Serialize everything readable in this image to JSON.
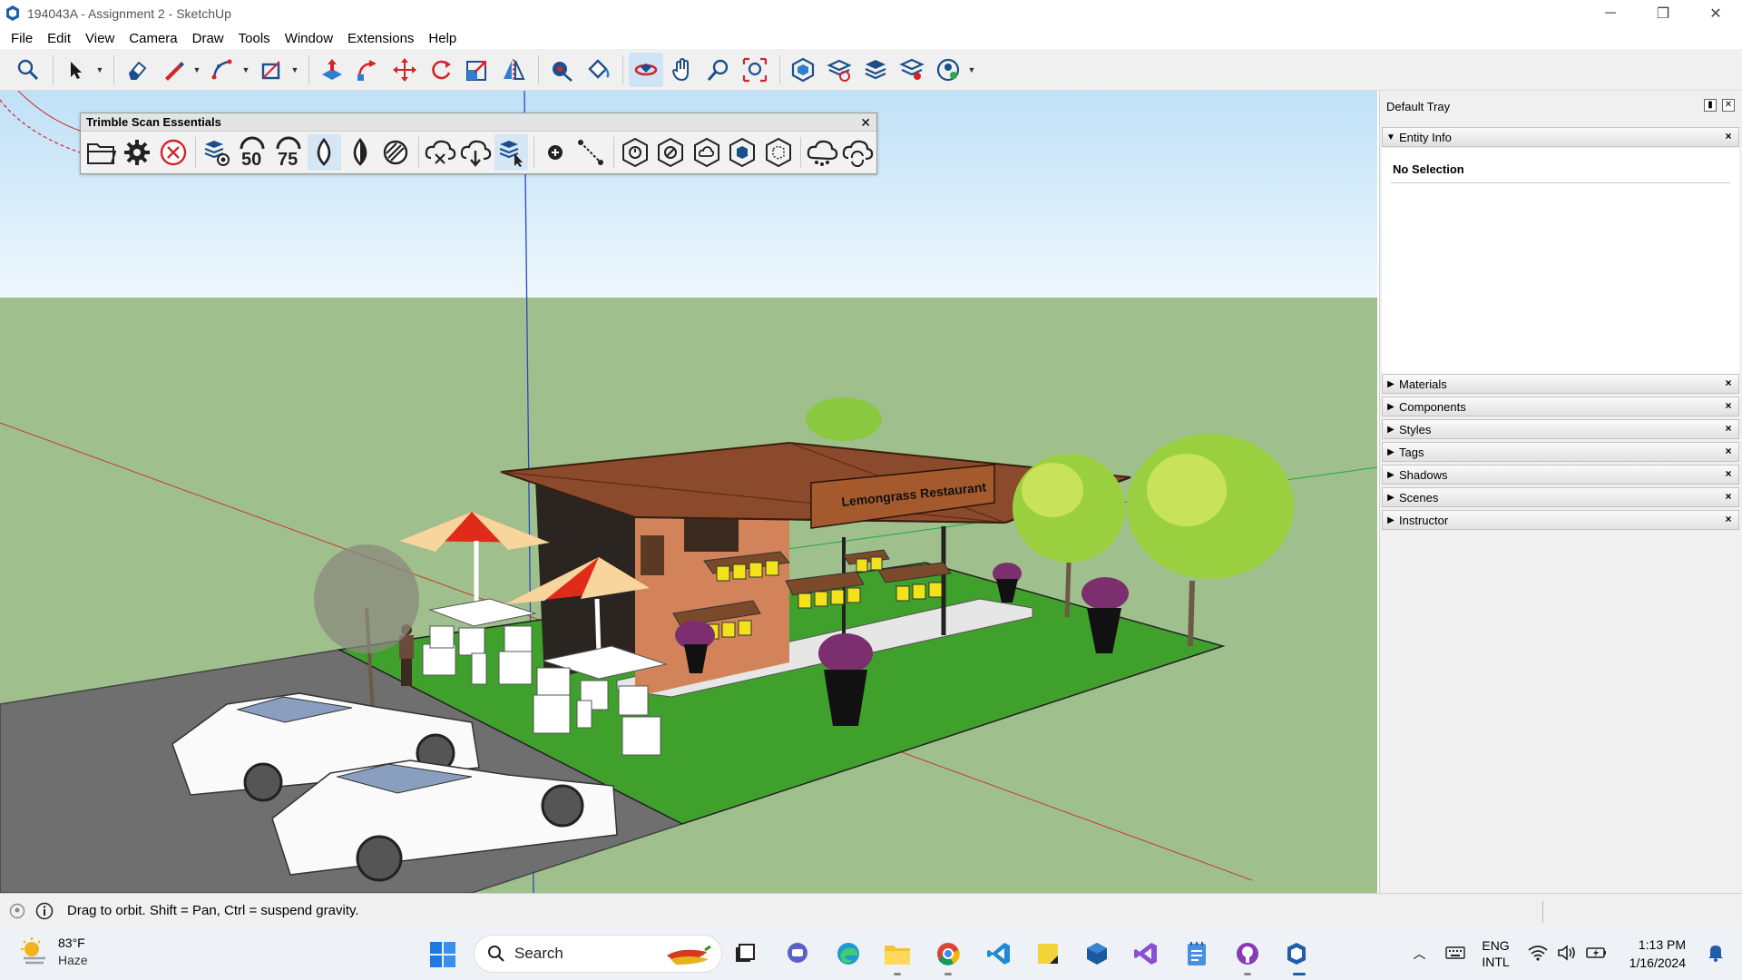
{
  "window": {
    "title": "194043A - Assignment 2 - SketchUp",
    "minimize": "─",
    "restore": "❐",
    "close": "✕"
  },
  "menu": [
    "File",
    "Edit",
    "View",
    "Camera",
    "Draw",
    "Tools",
    "Window",
    "Extensions",
    "Help"
  ],
  "toolbar": {
    "tools": [
      "search",
      "select",
      "eraser",
      "line",
      "arc",
      "rectangle",
      "push-pull",
      "follow-me",
      "move",
      "rotate",
      "scale",
      "flip",
      "tape-measure",
      "paint-bucket",
      "orbit",
      "pan",
      "zoom",
      "zoom-extents",
      "warehouse",
      "extension-warehouse",
      "layout",
      "extension-manager",
      "account"
    ],
    "active": "orbit"
  },
  "scan_toolbar": {
    "title": "Trimble Scan Essentials",
    "close": "✕",
    "labels": {
      "fifty": "50",
      "seventyfive": "75"
    }
  },
  "model": {
    "sign_text": "Lemongrass Restaurant",
    "colors": {
      "sky": "#e8f4fb",
      "ground": "#9fc08c",
      "lawn": "#3fa02c",
      "roof": "#8b4a2b",
      "umbrella": "#e02a1a",
      "chairs": "#f2e21a"
    }
  },
  "tray": {
    "title": "Default Tray",
    "entity_info": {
      "label": "Entity Info",
      "body": "No Selection"
    },
    "panels": [
      "Materials",
      "Components",
      "Styles",
      "Tags",
      "Shadows",
      "Scenes",
      "Instructor"
    ]
  },
  "status": {
    "text": "Drag to orbit. Shift = Pan, Ctrl = suspend gravity."
  },
  "taskbar": {
    "weather": {
      "temp": "83°F",
      "condition": "Haze"
    },
    "search_placeholder": "Search",
    "language": {
      "line1": "ENG",
      "line2": "INTL"
    },
    "clock": {
      "time": "1:13 PM",
      "date": "1/16/2024"
    }
  }
}
